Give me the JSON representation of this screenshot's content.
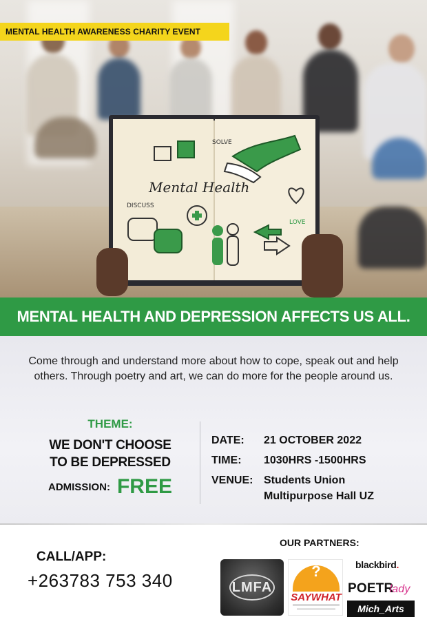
{
  "event": {
    "banner": "MENTAL HEALTH AWARENESS CHARITY EVENT",
    "headline": "MENTAL HEALTH AND DEPRESSION AFFECTS US ALL.",
    "intro": "Come through and understand more about how to cope, speak out and help others. Through poetry and art, we can do more for the people around us."
  },
  "notebook": {
    "title": "Mental Health",
    "solve": "SOLVE",
    "discuss": "DISCUSS",
    "love": "LOVE"
  },
  "theme": {
    "label": "THEME:",
    "line1": "WE DON'T CHOOSE",
    "line2": "TO BE DEPRESSED",
    "admission_label": "ADMISSION:",
    "admission_value": "FREE"
  },
  "details": {
    "date_label": "DATE:",
    "date_value": "21 OCTOBER 2022",
    "time_label": "TIME:",
    "time_value": "1030HRS -1500HRS",
    "venue_label": "VENUE:",
    "venue_line1": "Students Union",
    "venue_line2": "Multipurpose Hall UZ"
  },
  "contact": {
    "label": "CALL/APP:",
    "phone": "+263783 753 340"
  },
  "partners": {
    "label": "OUR PARTNERS:",
    "logos": {
      "lmfa": "LMFA",
      "saywhat": "SAYWHAT",
      "saywhat_mark": "?",
      "blackbird": "blackbird",
      "blackbird_dot": ".",
      "poetry": "POETR",
      "poetry_script": "lady",
      "mich": "Mich_Arts"
    }
  },
  "colors": {
    "green": "#2f9a45",
    "yellow": "#f4d51c"
  }
}
